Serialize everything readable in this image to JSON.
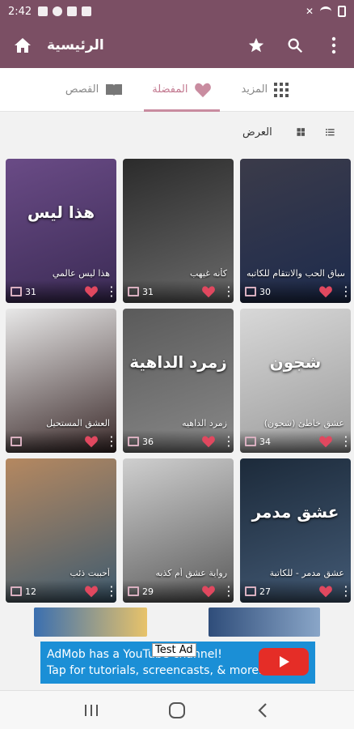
{
  "status_bar": {
    "time": "2:42",
    "icons": [
      "shopping-icon",
      "facebook-icon",
      "image-icon",
      "youtube-icon"
    ],
    "right_icons": [
      "mute-icon",
      "wifi-icon",
      "battery-icon"
    ]
  },
  "app_bar": {
    "title": "الرئيسية",
    "color": "#7b4f64",
    "icons": [
      "home-icon",
      "star-icon",
      "search-icon",
      "more-vert-icon"
    ]
  },
  "tabs": [
    {
      "label": "القصص",
      "icon": "book-icon",
      "active": false
    },
    {
      "label": "المفضلة",
      "icon": "heart-icon",
      "active": true
    },
    {
      "label": "المزيد",
      "icon": "grid-icon",
      "active": false
    }
  ],
  "view": {
    "label": "العرض",
    "icons": [
      "grid-view-icon",
      "list-view-icon"
    ]
  },
  "cards": [
    {
      "title": "سباق الحب والانتقام للكاتبه sally jabbar",
      "count": "30",
      "cover_text": "",
      "colors": [
        "#3b3b4a",
        "#1d2b4d"
      ]
    },
    {
      "title": "كأنه غيهب",
      "count": "31",
      "cover_text": "",
      "colors": [
        "#2b2b2b",
        "#6a6a6a"
      ]
    },
    {
      "title": "هذا ليس عالمي",
      "count": "31",
      "cover_text": "هذا ليس",
      "colors": [
        "#6a4b86",
        "#3b2b55"
      ]
    },
    {
      "title": "عشق خاطئ (شجون)",
      "count": "34",
      "cover_text": "شجون",
      "colors": [
        "#d8d8d8",
        "#9a9a9a"
      ]
    },
    {
      "title": "زمرد الداهيه",
      "count": "36",
      "cover_text": "زمرد الداهية",
      "colors": [
        "#5a5a5a",
        "#888888"
      ]
    },
    {
      "title": "العشق المستحيل",
      "count": "",
      "cover_text": "",
      "colors": [
        "#e8e8e8",
        "#3b2a2a"
      ]
    },
    {
      "title": "عشق مدمر - للكاتبة",
      "count": "27",
      "cover_text": "عشق مدمر",
      "colors": [
        "#1c2a3a",
        "#435a75"
      ]
    },
    {
      "title": "رواية عشق أم كذبه",
      "count": "29",
      "cover_text": "",
      "colors": [
        "#cfcfcf",
        "#5a5a5a"
      ]
    },
    {
      "title": "أحببت ذئب",
      "count": "12",
      "cover_text": "",
      "colors": [
        "#b58860",
        "#3e5b70"
      ]
    }
  ],
  "ad": {
    "label": "Test Ad",
    "line1": "AdMob has a YouTube channel!",
    "line2": "Tap for tutorials, screencasts, & more.",
    "color": "#1b8fd6"
  },
  "nav": {
    "icons": [
      "recents-icon",
      "home-nav-icon",
      "back-icon"
    ]
  }
}
